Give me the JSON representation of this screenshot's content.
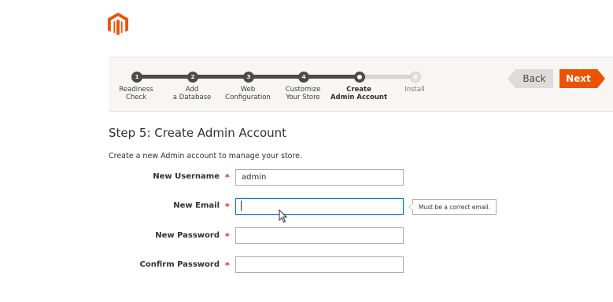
{
  "brand": {
    "logo_icon": "magento-logo-icon",
    "accent_color": "#eb5202"
  },
  "wizard": {
    "steps": [
      {
        "number": "1",
        "label": "Readiness\nCheck",
        "status": "done"
      },
      {
        "number": "2",
        "label": "Add\na Database",
        "status": "done"
      },
      {
        "number": "3",
        "label": "Web\nConfiguration",
        "status": "done"
      },
      {
        "number": "4",
        "label": "Customize\nYour Store",
        "status": "done"
      },
      {
        "number": "5",
        "label": "Create\nAdmin Account",
        "status": "active"
      },
      {
        "number": "6",
        "label": "Install",
        "status": "todo"
      }
    ],
    "back_label": "Back",
    "next_label": "Next"
  },
  "page": {
    "title": "Step 5: Create Admin Account",
    "intro": "Create a new Admin account to manage your store."
  },
  "form": {
    "required_marker": "*",
    "username": {
      "label": "New Username",
      "value": "admin"
    },
    "email": {
      "label": "New Email",
      "value": "",
      "tooltip": "Must be a correct email."
    },
    "password": {
      "label": "New Password",
      "value": ""
    },
    "confirm_password": {
      "label": "Confirm Password",
      "value": ""
    }
  }
}
